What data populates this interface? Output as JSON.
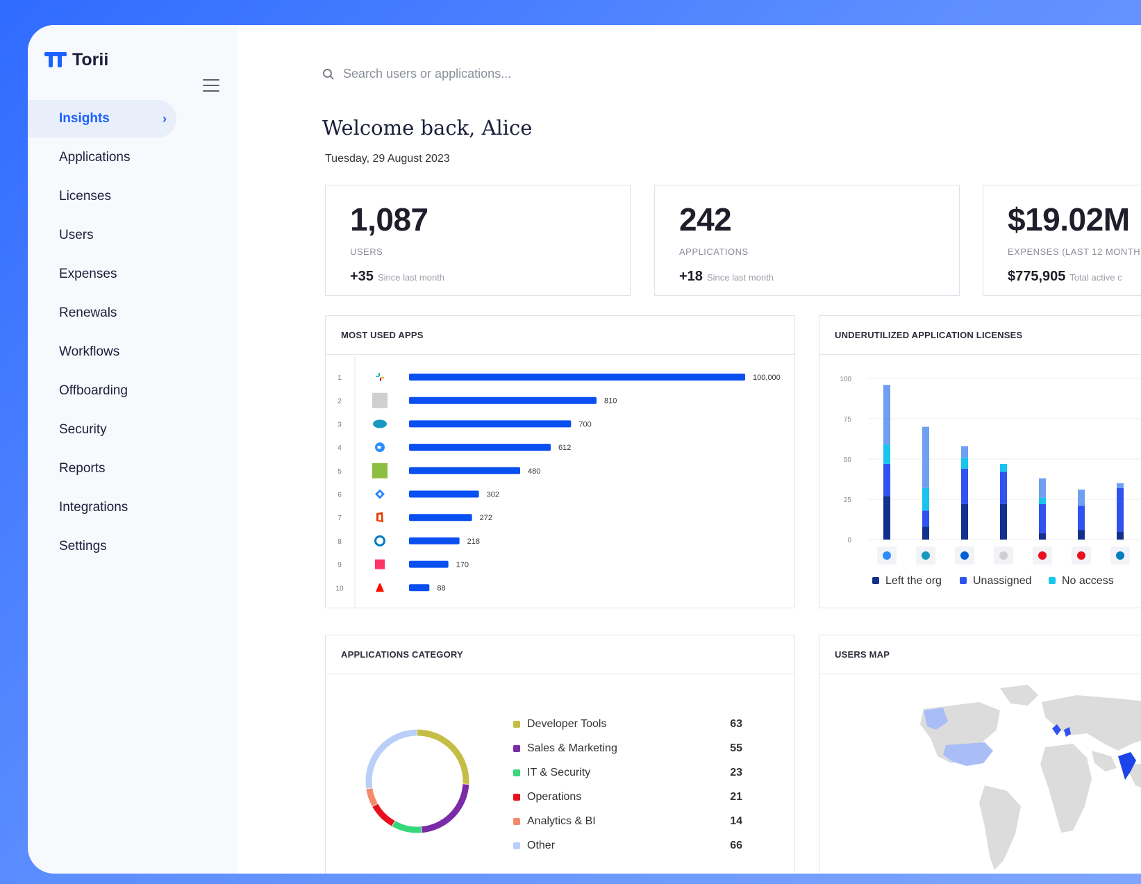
{
  "app": {
    "name": "Torii"
  },
  "sidebar": {
    "items": [
      {
        "label": "Insights"
      },
      {
        "label": "Applications"
      },
      {
        "label": "Licenses"
      },
      {
        "label": "Users"
      },
      {
        "label": "Expenses"
      },
      {
        "label": "Renewals"
      },
      {
        "label": "Workflows"
      },
      {
        "label": "Offboarding"
      },
      {
        "label": "Security"
      },
      {
        "label": "Reports"
      },
      {
        "label": "Integrations"
      },
      {
        "label": "Settings"
      }
    ],
    "active": "Insights"
  },
  "search": {
    "placeholder": "Search users or applications..."
  },
  "header": {
    "welcome": "Welcome back, Alice",
    "date": "Tuesday, 29 August 2023"
  },
  "stats": [
    {
      "value": "1,087",
      "label": "USERS",
      "delta": "+35",
      "delta_note": "Since last month"
    },
    {
      "value": "242",
      "label": "APPLICATIONS",
      "delta": "+18",
      "delta_note": "Since last month"
    },
    {
      "value": "$19.02M",
      "label": "EXPENSES (LAST 12 MONTH",
      "delta": "$775,905",
      "delta_note": "Total active c"
    }
  ],
  "colors": {
    "accent": "#1c62ff",
    "bar": "#0a4ff0",
    "left_org": "#13308c",
    "unassigned": "#2f52f0",
    "no_access": "#19c5ee",
    "other_top": "#6f9ff0"
  },
  "most_used_apps": {
    "title": "MOST USED APPS",
    "rows": [
      {
        "rank": "1",
        "icon": "slack-icon",
        "value": 100000,
        "label": "100,000"
      },
      {
        "rank": "2",
        "icon": "gsuite-icon",
        "value": 810,
        "label": "810"
      },
      {
        "rank": "3",
        "icon": "salesforce-icon",
        "value": 700,
        "label": "700"
      },
      {
        "rank": "4",
        "icon": "zoom-icon",
        "value": 612,
        "label": "612"
      },
      {
        "rank": "5",
        "icon": "app-green-icon",
        "value": 480,
        "label": "480"
      },
      {
        "rank": "6",
        "icon": "jira-icon",
        "value": 302,
        "label": "302"
      },
      {
        "rank": "7",
        "icon": "office-icon",
        "value": 272,
        "label": "272"
      },
      {
        "rank": "8",
        "icon": "okta-icon",
        "value": 218,
        "label": "218"
      },
      {
        "rank": "9",
        "icon": "invision-icon",
        "value": 170,
        "label": "170"
      },
      {
        "rank": "10",
        "icon": "adobe-icon",
        "value": 88,
        "label": "88"
      }
    ]
  },
  "underutilized": {
    "title": "UNDERUTILIZED APPLICATION LICENSES",
    "legend": [
      "Left the org",
      "Unassigned",
      "No access"
    ]
  },
  "categories": {
    "title": "APPLICATIONS CATEGORY",
    "items": [
      {
        "name": "Developer Tools",
        "count": 63,
        "color": "#c5bd45"
      },
      {
        "name": "Sales & Marketing",
        "count": 55,
        "color": "#7b2aa8"
      },
      {
        "name": "IT & Security",
        "count": 23,
        "color": "#36d77b"
      },
      {
        "name": "Operations",
        "count": 21,
        "color": "#e8101f"
      },
      {
        "name": "Analytics & BI",
        "count": 14,
        "color": "#f48a6b"
      },
      {
        "name": "Other",
        "count": 66,
        "color": "#b9cff7"
      }
    ]
  },
  "users_map": {
    "title": "USERS MAP"
  },
  "chart_data": [
    {
      "type": "bar",
      "title": "MOST USED APPS",
      "orientation": "horizontal",
      "categories": [
        "1",
        "2",
        "3",
        "4",
        "5",
        "6",
        "7",
        "8",
        "9",
        "10"
      ],
      "values": [
        100000,
        810,
        700,
        612,
        480,
        302,
        272,
        218,
        170,
        88
      ]
    },
    {
      "type": "bar",
      "title": "UNDERUTILIZED APPLICATION LICENSES",
      "stacked": true,
      "categories": [
        "zoom",
        "salesforce",
        "box",
        "gsuite",
        "app5",
        "adobe-cc",
        "okta"
      ],
      "ylim": [
        0,
        100
      ],
      "yticks": [
        0,
        25,
        50,
        75,
        100
      ],
      "series": [
        {
          "name": "Left the org",
          "values": [
            27,
            8,
            22,
            22,
            4,
            6,
            5
          ]
        },
        {
          "name": "Unassigned",
          "values": [
            20,
            10,
            22,
            20,
            18,
            15,
            27
          ]
        },
        {
          "name": "No access",
          "values": [
            12,
            14,
            7,
            5,
            4,
            0,
            0
          ]
        },
        {
          "values": [
            37,
            38,
            7,
            0,
            12,
            10,
            3
          ]
        }
      ],
      "legend_position": "bottom"
    },
    {
      "type": "pie",
      "title": "APPLICATIONS CATEGORY",
      "donut": true,
      "labels": [
        "Developer Tools",
        "Sales & Marketing",
        "IT & Security",
        "Operations",
        "Analytics & BI",
        "Other"
      ],
      "values": [
        63,
        55,
        23,
        21,
        14,
        66
      ]
    }
  ]
}
